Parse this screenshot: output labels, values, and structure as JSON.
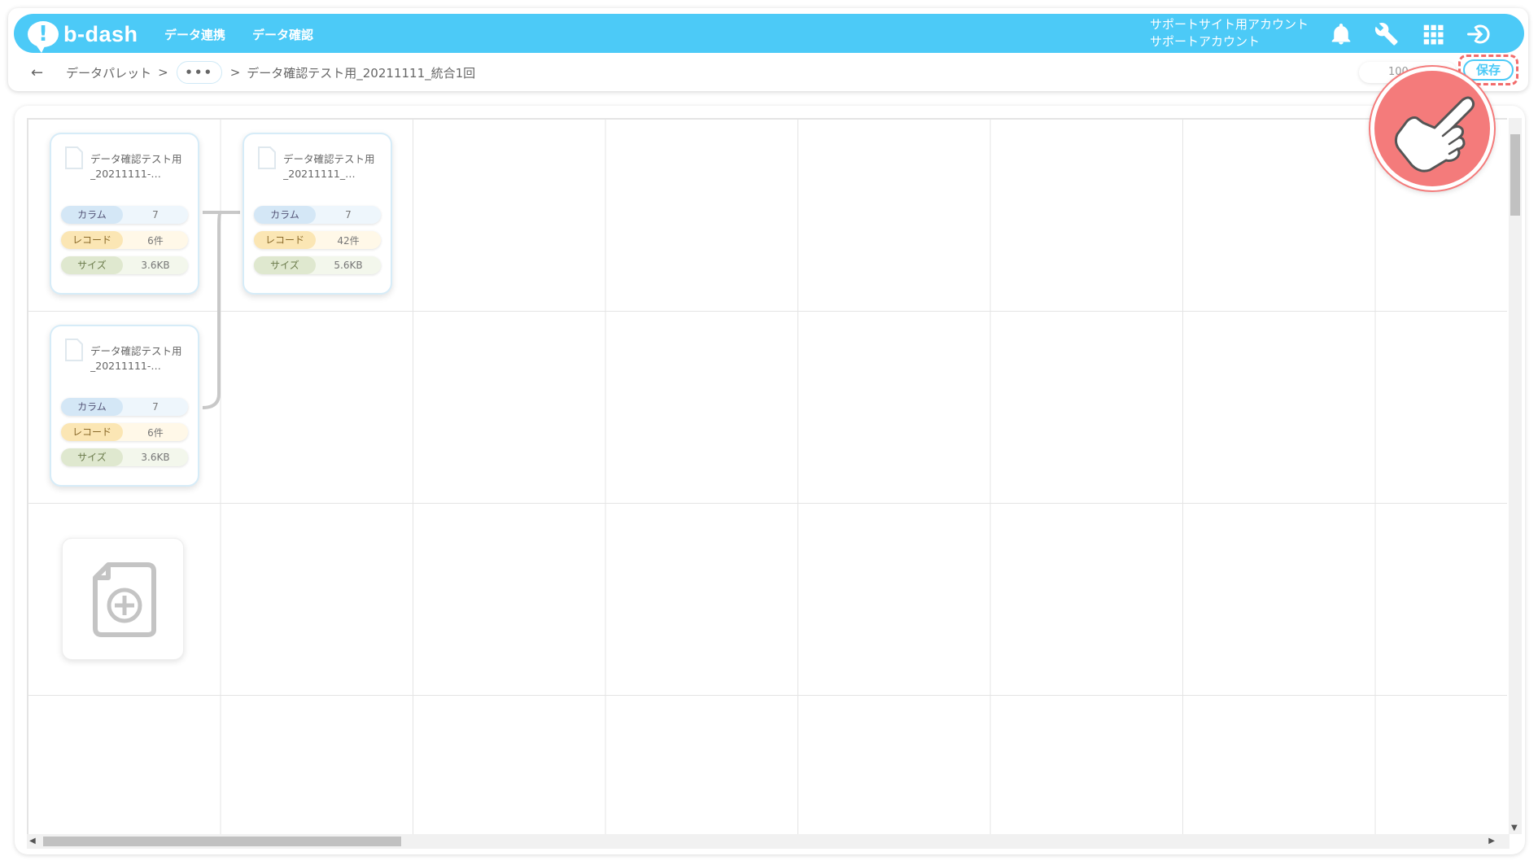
{
  "header": {
    "logo_text": "b-dash",
    "nav": [
      "データ連携",
      "データ確認"
    ],
    "account_line1": "サポートサイト用アカウント",
    "account_line2": "サポートアカウント",
    "icons": [
      "bell-icon",
      "wrench-icon",
      "grid-icon",
      "logout-icon"
    ]
  },
  "breadcrumb": {
    "back": "←",
    "root": "データパレット",
    "sep": ">",
    "ellipsis": "•••",
    "current": "データ確認テスト用_20211111_統合1回"
  },
  "toolbar": {
    "zoom": "100",
    "save_label": "保存"
  },
  "labels": {
    "column": "カラム",
    "record": "レコード",
    "size": "サイズ"
  },
  "cards": [
    {
      "title": "データ確認テスト用_20211111-…",
      "columns": "7",
      "records": "6件",
      "size": "3.6KB"
    },
    {
      "title": "データ確認テスト用_20211111_…",
      "columns": "7",
      "records": "42件",
      "size": "5.6KB"
    },
    {
      "title": "データ確認テスト用_20211111-…",
      "columns": "7",
      "records": "6件",
      "size": "3.6KB"
    }
  ],
  "colors": {
    "header": "#4ccaf7",
    "save_highlight": "#f26b6b",
    "pointer": "#f47b7b"
  }
}
